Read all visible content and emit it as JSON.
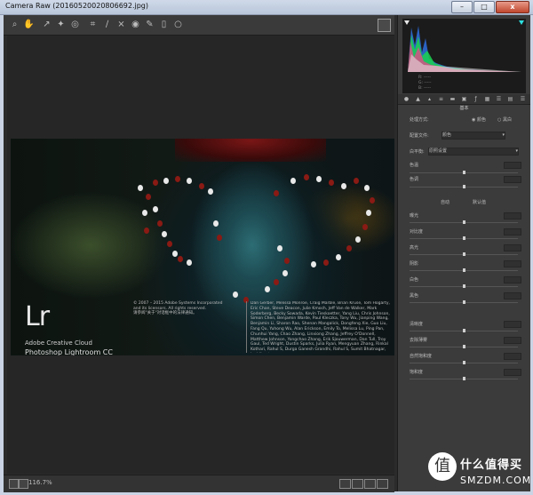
{
  "window": {
    "title": "Camera Raw (20160520020806692.jpg)",
    "minimize": "–",
    "maximize": "□",
    "close": "x"
  },
  "toolbar": {
    "tools": [
      "zoom",
      "hand",
      "white-balance",
      "color-sampler",
      "targeted-adjust",
      "crop",
      "straighten",
      "spot-removal",
      "red-eye",
      "adjustment-brush",
      "graduated-filter",
      "radial-filter"
    ]
  },
  "splash": {
    "logo": "Lr",
    "cloud": "Adobe Creative Cloud",
    "product": "Photoshop Lightroom CC",
    "copyright_lines": [
      "© 2007 – 2015 Adobe Systems Incorporated",
      "and its licensors. All rights reserved.",
      "",
      "请参阅\"关于\"对话框中的法律通知。"
    ],
    "credits": "Dan Gerber, Melissa Monroe, Craig Marble, Brian Kruse, Tom Hogarty, Eric Chan, Steve Deacon, Julie Kmoch, Jeff Van de Walker, Mark Soderberg, Becky Sowada, Kevin Tieskoetter, Yang Liu, Chris Johnson, Simon Chen, Benjamin Warde, Paul Kleczka, Tony Wu, Jianping Wang, Benjamin Li, Sharon Rao, Shenan Mangalick, Dongfeng Xie, Guo Liu, Fang Qu, Yuhong Wu, Alan Erickson, Emily To, Melissa Lu, Ping Pan, Chunhui Yang, Chao Zhang, Linxiong Zhang, Jeffrey O'Donnell, Matthew Johnson, Yongchao Zhang, Erik Sjouwerman, Dan Tull, Troy Gaul, Ted Wright, Dustin Sparks, Julia Ryan, Mengyuan Zhang, Rinkal Kothari, Rahul S, Durga Ganesh Grandhi, Rahul S, Sumit Bhatnagar, Joel Kreutz"
  },
  "bottombar": {
    "zoom": "116.7%"
  },
  "histogram": {
    "r": "R:  -----",
    "g": "G:  -----",
    "b": "B:  -----"
  },
  "panel": {
    "section": "基本",
    "treatment_label": "处理方式:",
    "treatment_color": "颜色",
    "treatment_bw": "黑白",
    "profile_label": "配置文件:",
    "profile_value": "颜色",
    "wb_label": "白平衡:",
    "wb_value": "原照设置",
    "temp": "色温",
    "tint": "色调",
    "auto": "自动",
    "default": "默认值",
    "sliders": [
      "曝光",
      "对比度",
      "高光",
      "阴影",
      "白色",
      "黑色"
    ],
    "presence": [
      "清晰度",
      "去除薄雾",
      "自然饱和度",
      "饱和度"
    ]
  },
  "brand": {
    "name": "什么值得买",
    "url": "SMZDM.COM",
    "logo": "值"
  }
}
